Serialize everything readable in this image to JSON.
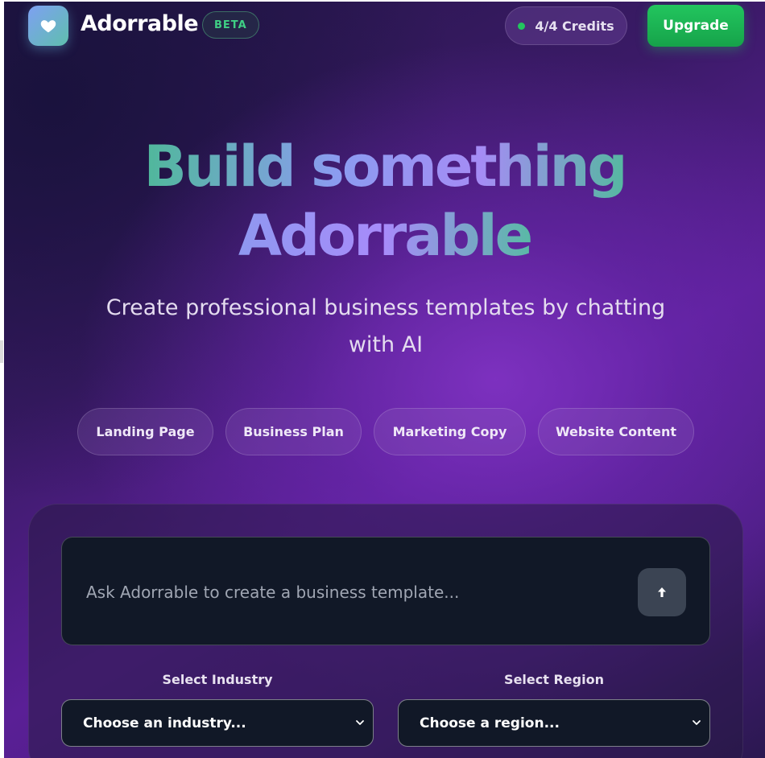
{
  "header": {
    "brand": "Adorrable",
    "badge": "BETA",
    "credits": "4/4 Credits",
    "upgrade_label": "Upgrade"
  },
  "hero": {
    "title_line1": "Build something",
    "title_line2": "Adorrable",
    "subtitle": "Create professional business templates by chatting with AI"
  },
  "chips": [
    {
      "label": "Landing Page"
    },
    {
      "label": "Business Plan"
    },
    {
      "label": "Marketing Copy"
    },
    {
      "label": "Website Content"
    }
  ],
  "prompt": {
    "placeholder": "Ask Adorrable to create a business template...",
    "value": ""
  },
  "selects": {
    "industry": {
      "label": "Select Industry",
      "value": "Choose an industry..."
    },
    "region": {
      "label": "Select Region",
      "value": "Choose a region..."
    }
  },
  "icons": {
    "logo": "heart-icon",
    "credits": "status-dot-icon",
    "send": "arrow-up-icon",
    "dropdown": "chevron-down-icon"
  },
  "colors": {
    "accent_green": "#22c55e",
    "badge_green": "#3fcf84",
    "input_bg": "#111827",
    "send_bg": "#3b4453"
  }
}
